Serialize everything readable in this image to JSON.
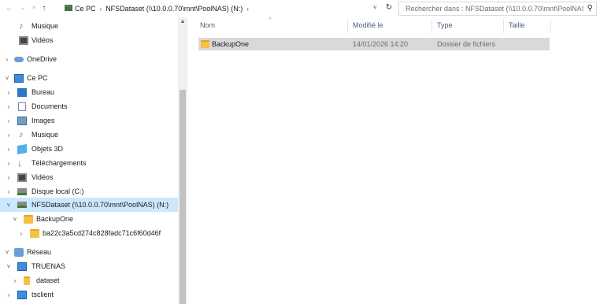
{
  "address_bar": {
    "back_icon": "arrow-left-icon",
    "forward_icon": "arrow-right-icon",
    "recent_icon": "chevron-down-icon",
    "up_icon": "arrow-up-icon",
    "crumbs": [
      "Ce PC",
      "NFSDataset (\\\\10.0.0.70\\mnt\\PoolNAS) (N:)"
    ],
    "refresh_icon": "refresh-icon",
    "search_placeholder": "Rechercher dans : NFSDataset (\\\\10.0.0.70\\mnt\\PoolNAS...",
    "search_icon": "search-icon"
  },
  "nav": {
    "items": [
      {
        "label": "Musique",
        "icon": "music-icon",
        "expand": ""
      },
      {
        "label": "Vidéos",
        "icon": "video-icon",
        "expand": ""
      },
      {
        "label": "OneDrive",
        "icon": "cloud-icon",
        "expand": ">"
      },
      {
        "label": "Ce PC",
        "icon": "pc-icon",
        "expand": "v"
      },
      {
        "label": "Bureau",
        "icon": "desktop-icon",
        "expand": ">"
      },
      {
        "label": "Documents",
        "icon": "document-icon",
        "expand": ">"
      },
      {
        "label": "Images",
        "icon": "images-icon",
        "expand": ">"
      },
      {
        "label": "Musique",
        "icon": "music-icon",
        "expand": ">"
      },
      {
        "label": "Objets 3D",
        "icon": "cube-icon",
        "expand": ">"
      },
      {
        "label": "Téléchargements",
        "icon": "download-icon",
        "expand": ">"
      },
      {
        "label": "Vidéos",
        "icon": "video-icon",
        "expand": ">"
      },
      {
        "label": "Disque local (C:)",
        "icon": "drive-icon",
        "expand": ">"
      },
      {
        "label": "NFSDataset (\\\\10.0.0.70\\mnt\\PoolNAS) (N:)",
        "icon": "network-drive-icon",
        "expand": "v"
      },
      {
        "label": "BackupOne",
        "icon": "folder-icon",
        "expand": "v"
      },
      {
        "label": "ba22c3a5cd274c828fadc71c6f60d46f",
        "icon": "folder-icon",
        "expand": ">"
      },
      {
        "label": "Réseau",
        "icon": "network-icon",
        "expand": "v"
      },
      {
        "label": "TRUENAS",
        "icon": "computer-icon",
        "expand": "v"
      },
      {
        "label": "dataset",
        "icon": "shared-folder-icon",
        "expand": ">"
      },
      {
        "label": "tsclient",
        "icon": "computer-icon",
        "expand": ">"
      }
    ],
    "selected_index": 12
  },
  "list": {
    "columns": [
      "Nom",
      "Modifié le",
      "Type",
      "Taille"
    ],
    "rows": [
      {
        "name": "BackupOne",
        "modified": "14/01/2026 14:20",
        "type": "Dossier de fichiers",
        "size": ""
      }
    ]
  }
}
